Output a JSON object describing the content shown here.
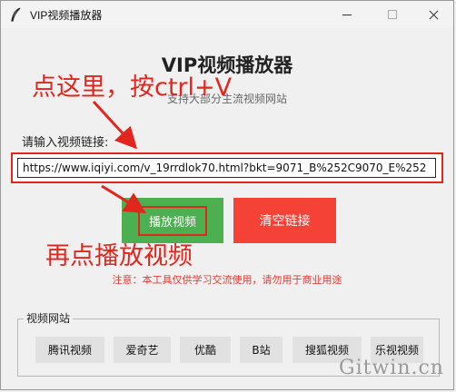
{
  "window": {
    "title": "VIP视频播放器"
  },
  "header": {
    "title": "VIP视频播放器",
    "subtitle": "支持大部分主流视频网站"
  },
  "input": {
    "label": "请输入视频链接:",
    "value": "https://www.iqiyi.com/v_19rrdlok70.html?bkt=9071_B%252C9070_E%252"
  },
  "buttons": {
    "play": "播放视频",
    "clear": "清空链接"
  },
  "notice": "注意：本工具仅供学习交流使用，请勿用于商业用途",
  "sites": {
    "group_label": "视频网站",
    "items": [
      "腾讯视频",
      "爱奇艺",
      "优酷",
      "B站",
      "搜狐视频",
      "乐视视频"
    ]
  },
  "annotations": {
    "top": "点这里，按ctrl+V",
    "bottom": "再点播放视频",
    "color": "#e0261d"
  },
  "watermark": "Gitwin.cn",
  "colors": {
    "play_button": "#4caf50",
    "clear_button": "#f44336",
    "notice": "#e53935"
  }
}
